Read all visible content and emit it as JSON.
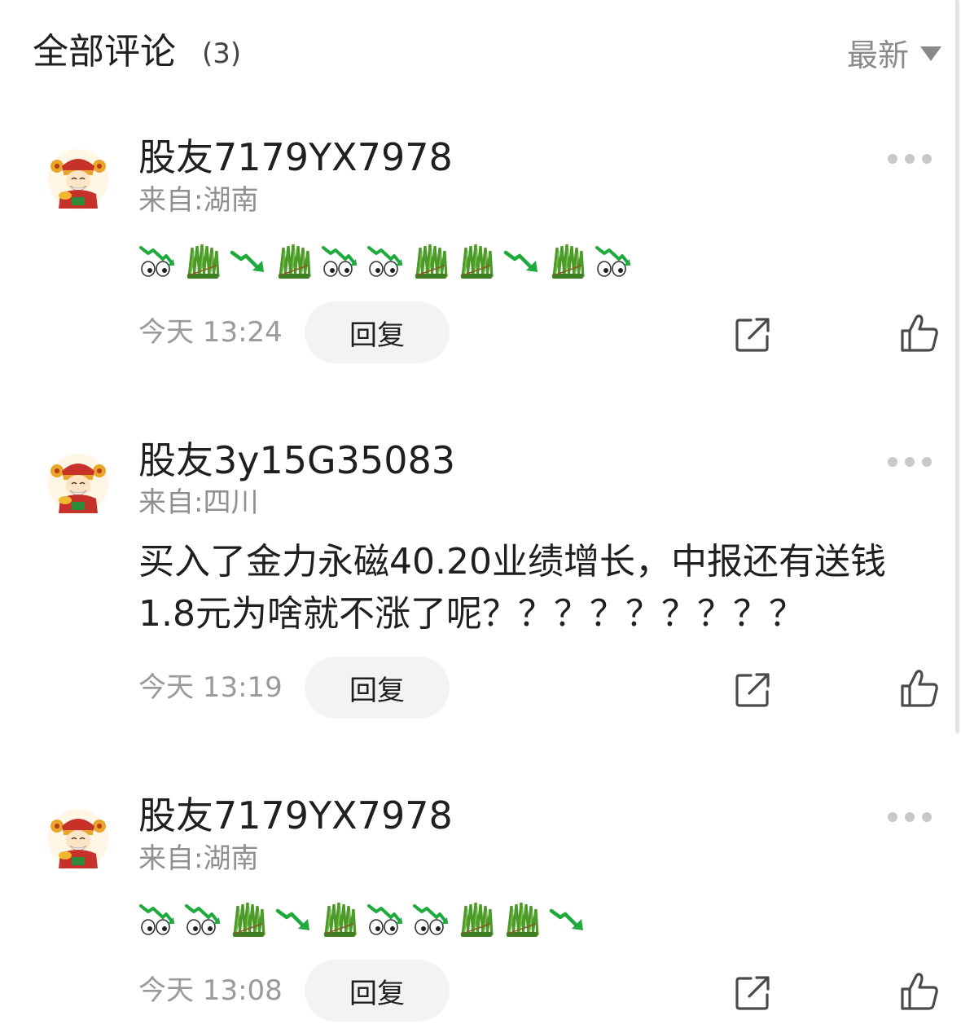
{
  "header": {
    "title": "全部评论",
    "count": "(3)",
    "sort_label": "最新",
    "sort_icon": "caret-down-icon"
  },
  "comments": [
    {
      "username": "股友7179YX7978",
      "location": "来自:湖南",
      "emojis": [
        "eyes-down-icon",
        "grass-icon",
        "falling-arrow-icon",
        "grass-icon",
        "eyes-down-icon",
        "eyes-down-icon",
        "grass-icon",
        "grass-icon",
        "falling-arrow-icon",
        "grass-icon",
        "eyes-down-icon"
      ],
      "time": "今天 13:24",
      "reply_label": "回复"
    },
    {
      "username": "股友3y15G35083",
      "location": "来自:四川",
      "text": "买入了金力永磁40.20业绩增长，中报还有送钱1.8元为啥就不涨了呢？？？？？？？？？",
      "time": "今天 13:19",
      "reply_label": "回复"
    },
    {
      "username": "股友7179YX7978",
      "location": "来自:湖南",
      "emojis": [
        "eyes-down-icon",
        "eyes-down-icon",
        "grass-icon",
        "falling-arrow-icon",
        "grass-icon",
        "eyes-down-icon",
        "eyes-down-icon",
        "grass-icon",
        "grass-icon",
        "falling-arrow-icon"
      ],
      "time": "今天 13:08",
      "reply_label": "回复"
    }
  ],
  "colors": {
    "emoji_green": "#1faa3c",
    "grass_green": "#4c9a2a",
    "text_muted": "#8f8f8f",
    "reply_bg": "#f3f3f3"
  }
}
